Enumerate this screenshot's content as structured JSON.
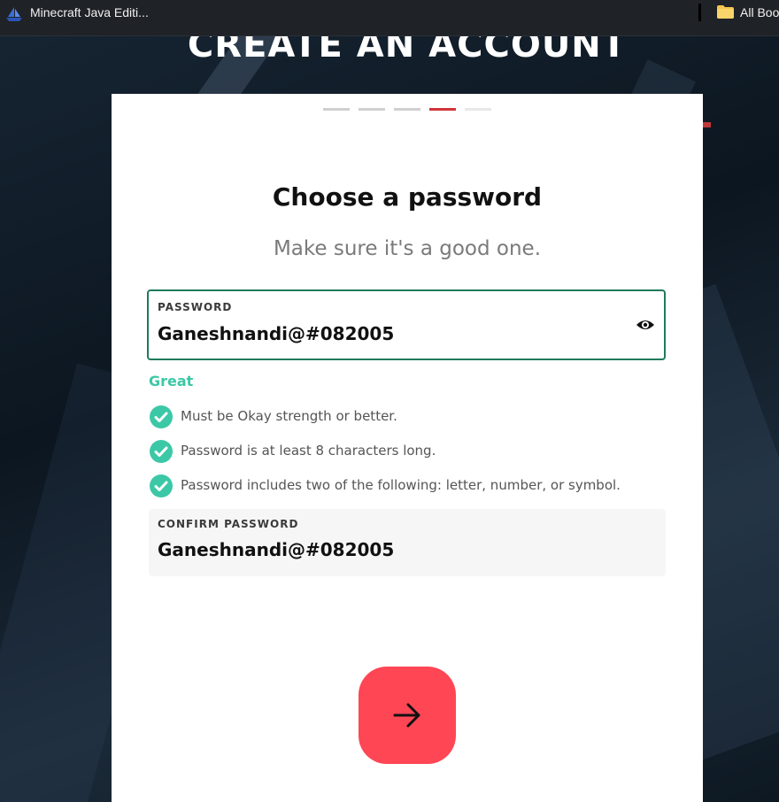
{
  "browser": {
    "tab_title": "Minecraft Java Editi...",
    "bookmarks_label": "All Boo"
  },
  "page": {
    "heading": "CREATE AN ACCOUNT"
  },
  "progress": {
    "total_steps": 5,
    "current_step": 4
  },
  "card": {
    "title": "Choose a password",
    "subtitle": "Make sure it's a good one."
  },
  "password_field": {
    "label": "PASSWORD",
    "value": "Ganeshnandi@#082005"
  },
  "strength": {
    "label": "Great",
    "color": "#3cc8a6"
  },
  "rules": [
    {
      "text": "Must be Okay strength or better.",
      "met": true
    },
    {
      "text": "Password is at least 8 characters long.",
      "met": true
    },
    {
      "text": "Password includes two of the following: letter, number, or symbol.",
      "met": true
    }
  ],
  "confirm_field": {
    "label": "CONFIRM PASSWORD",
    "value": "Ganeshnandi@#082005"
  },
  "colors": {
    "accent": "#ff4655",
    "focus_border": "#1f7a5c",
    "check": "#3cc8a6",
    "progress_active": "#d0353a"
  },
  "icons": {
    "tab": "sailboat-icon",
    "bookmarks": "folder-icon",
    "reveal": "eye-icon",
    "rule": "check-circle-icon",
    "next": "arrow-right-icon"
  }
}
